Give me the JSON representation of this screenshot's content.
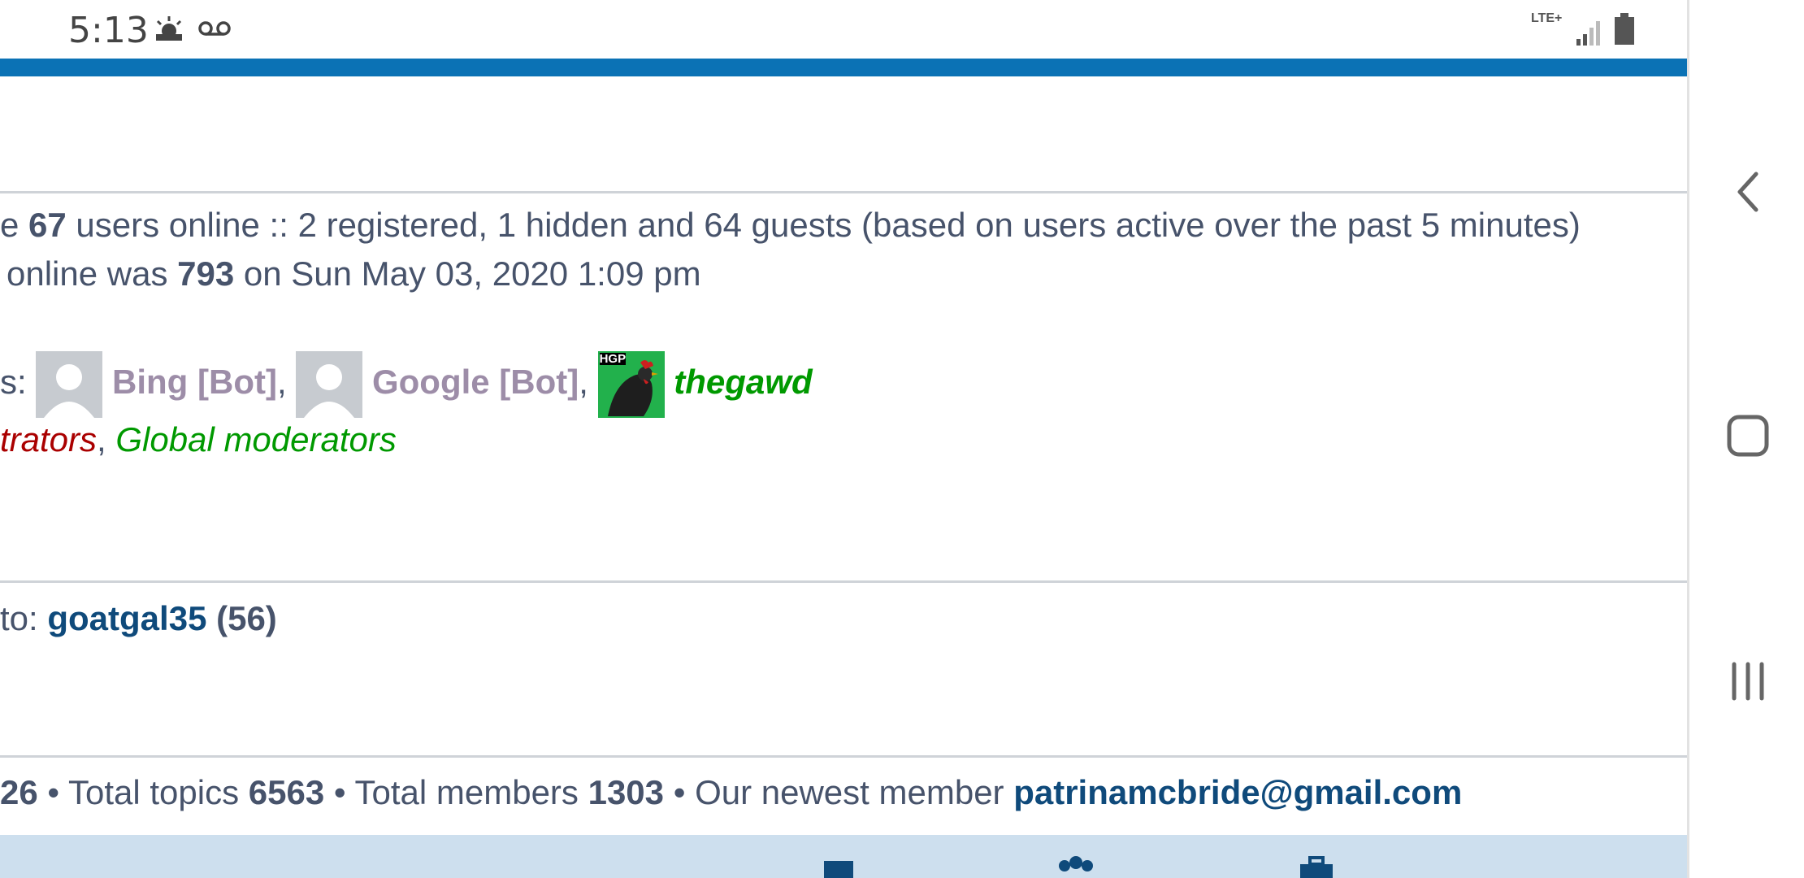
{
  "status_bar": {
    "time": "5:13",
    "icons": [
      "weather-icon",
      "voicemail-icon"
    ],
    "network": "LTE+",
    "right_icons": [
      "signal-icon",
      "battery-icon"
    ]
  },
  "online": {
    "users_count": "67",
    "users_text": " users online :: 2 registered, 1 hidden and 64 guests (based on users active over the past 5 minutes)",
    "prefix_e": "e ",
    "record_prefix": " online was ",
    "record_count": "793",
    "record_suffix": " on Sun May 03, 2020 1:09 pm"
  },
  "registered": {
    "prefix": "s: ",
    "users": [
      {
        "name": "Bing [Bot]",
        "sep": ","
      },
      {
        "name": "Google [Bot]",
        "sep": ","
      },
      {
        "name": "thegawd",
        "sep": ""
      }
    ],
    "avatar_label": "HGP"
  },
  "legend": {
    "admin": "trators",
    "sep": ", ",
    "global_mod": "Global moderators"
  },
  "birthday": {
    "prefix": " to: ",
    "user": "goatgal35",
    "age": " (56)"
  },
  "stats": {
    "prefix_num": "26",
    "topics_label": " • Total topics ",
    "topics": "6563",
    "members_label": " • Total members ",
    "members": "1303",
    "newest_label": " • Our newest member ",
    "newest": "patrinamcbride@gmail.com"
  },
  "navbar": {
    "buttons": [
      "back-button",
      "home-button",
      "recents-button"
    ]
  },
  "colors": {
    "accent": "#0b72b5",
    "admin": "#aa0000",
    "moderator": "#009900",
    "bot": "#9d8da8",
    "link": "#0f4a7b"
  }
}
